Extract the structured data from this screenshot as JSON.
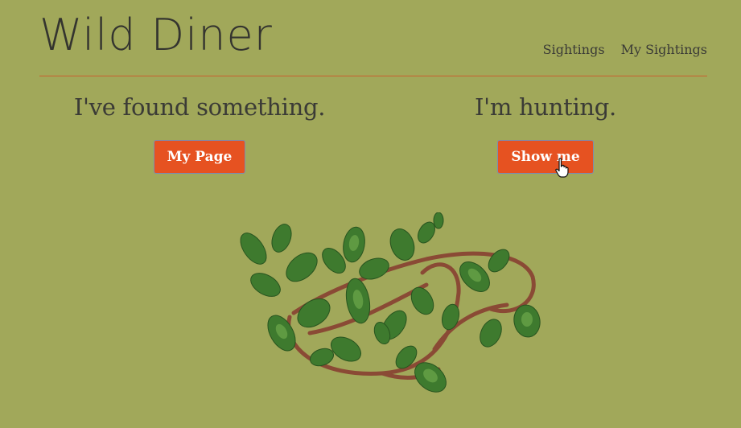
{
  "header": {
    "logo": "Wild Diner",
    "nav": [
      {
        "label": "Sightings"
      },
      {
        "label": "My Sightings"
      }
    ]
  },
  "left": {
    "heading": "I've found something.",
    "button": "My Page"
  },
  "right": {
    "heading": "I'm hunting.",
    "button": "Show me"
  },
  "icons": {
    "plant": "purslane-plant-image",
    "cursor": "hand-pointer-cursor-icon"
  },
  "colors": {
    "background": "#a1a85a",
    "accent": "#e65221",
    "rule": "#c9602e"
  }
}
